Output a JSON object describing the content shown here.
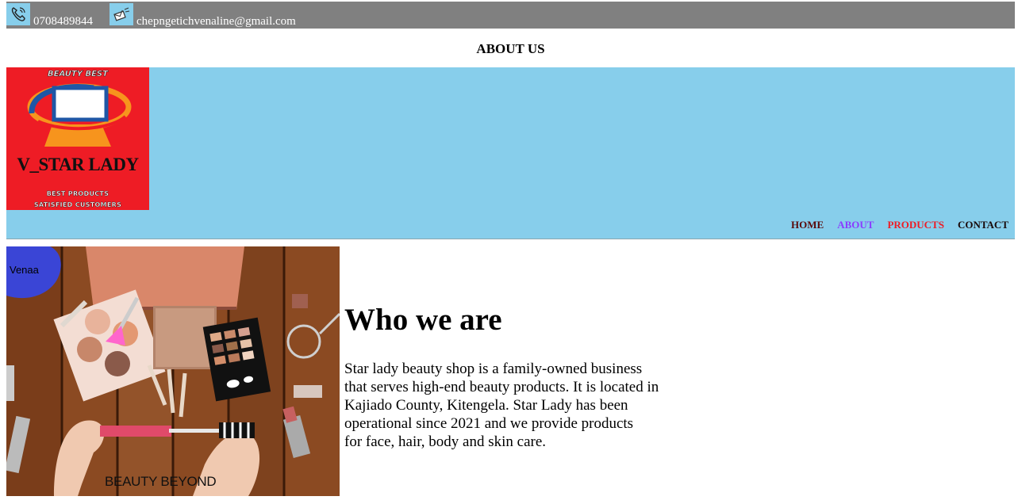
{
  "topbar": {
    "phone": "0708489844",
    "email": "chepngetichvenaline@gmail.com",
    "phone_icon": "phone-icon",
    "email_icon": "mail-icon"
  },
  "page": {
    "heading": "ABOUT US"
  },
  "logo": {
    "top_text": "BEAUTY BEST",
    "name": "V_STAR LADY",
    "line1": "BEST PRODUCTS",
    "line2": "SATISFIED CUSTOMERS"
  },
  "nav": {
    "items": [
      "HOME",
      "ABOUT",
      "PRODUCTS",
      "CONTACT"
    ]
  },
  "hero": {
    "badge": "Venaa",
    "caption": "BEAUTY BEYOND"
  },
  "about": {
    "title": "Who we are",
    "lines": [
      "Star lady beauty shop is a family-owned business",
      "that serves high-end beauty products. It is located in",
      "Kajiado County, Kitengela. Star Lady has been",
      "operational since 2021 and we provide products",
      "for face, hair, body and skin care."
    ]
  },
  "colors": {
    "topbar": "#808080",
    "header": "#87CEEB",
    "logo_bg": "#ee1c25",
    "nav_about": "#8a3dff",
    "nav_products": "#ee1c25"
  }
}
